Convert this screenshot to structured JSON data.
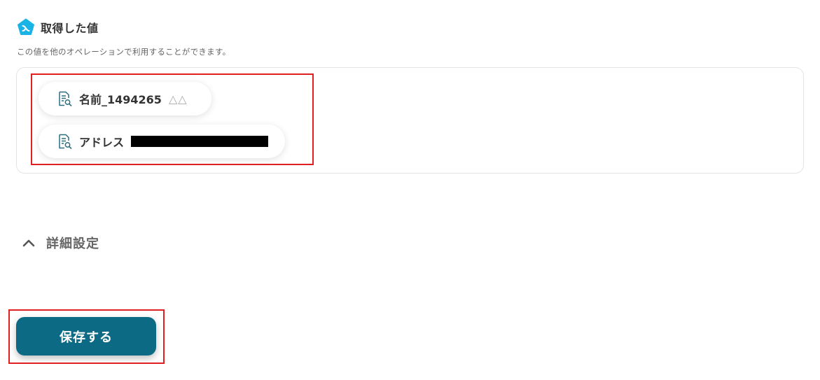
{
  "section": {
    "icon": "yoom-brand-icon",
    "title": "取得した値",
    "description": "この値を他のオペレーションで利用することができます。"
  },
  "values": [
    {
      "icon": "document-search-icon",
      "label": "名前_1494265",
      "value": "△△"
    },
    {
      "icon": "document-search-icon",
      "label": "アドレス",
      "value": "",
      "redacted": true
    }
  ],
  "advanced": {
    "icon": "chevron-up-icon",
    "label": "詳細設定"
  },
  "actions": {
    "save_label": "保存する"
  },
  "colors": {
    "accent": "#0d6a84",
    "brand_icon": "#1ab3e6",
    "highlight": "#e02020",
    "doc_icon": "#2a6f80"
  }
}
